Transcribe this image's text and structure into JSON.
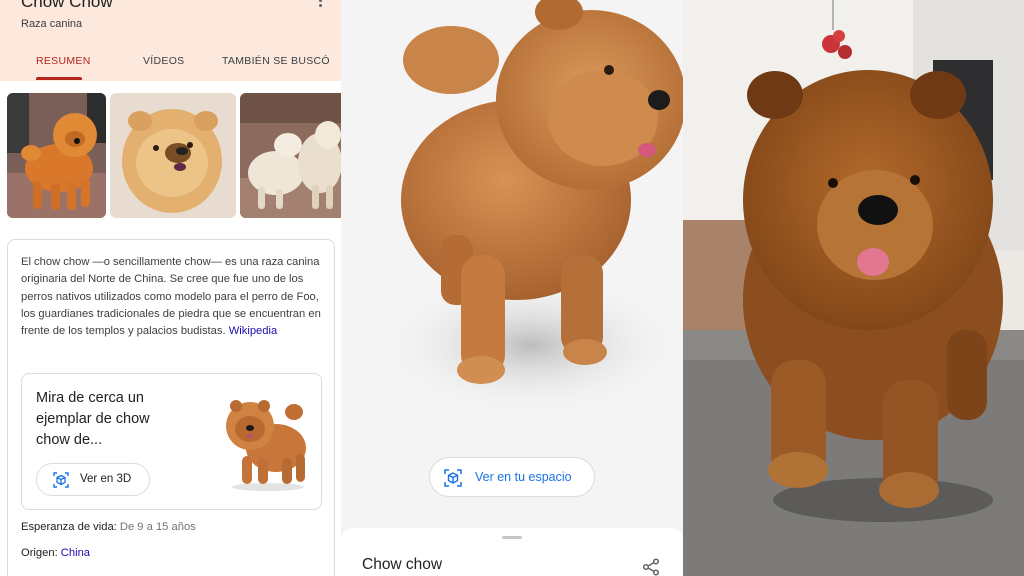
{
  "panel_search": {
    "title": "Chow Chow",
    "subtitle": "Raza canina",
    "tabs": [
      {
        "label": "RESUMEN",
        "active": true
      },
      {
        "label": "VÍDEOS",
        "active": false
      },
      {
        "label": "TAMBIÉN SE BUSCÓ",
        "active": false
      }
    ],
    "description": "El chow chow —o sencillamente chow— es una raza canina originaria del Norte de China. Se cree que  fue uno de los perros nativos utilizados como modelo para el perro de Foo, los guardianes tradicionales de piedra que se encuentran en frente de los templos y palacios budistas.",
    "description_link": "Wikipedia",
    "view3d_prompt": "Mira de cerca un ejemplar de chow chow de...",
    "view3d_button": "Ver en 3D",
    "facts": [
      {
        "key": "Esperanza de vida:",
        "value": "De 9 a 15 años"
      },
      {
        "key": "Origen:",
        "value": "China"
      }
    ]
  },
  "panel_3d": {
    "ar_button": "Ver en tu espacio",
    "sheet_title": "Chow chow"
  },
  "colors": {
    "accent_red": "#b3261e",
    "link_blue": "#1a73e8",
    "header_peach": "#fce8dd",
    "fur": "#c57a3a"
  },
  "icons": [
    "more-vert-icon",
    "cube-3d-icon",
    "ar-cube-icon",
    "share-icon"
  ]
}
